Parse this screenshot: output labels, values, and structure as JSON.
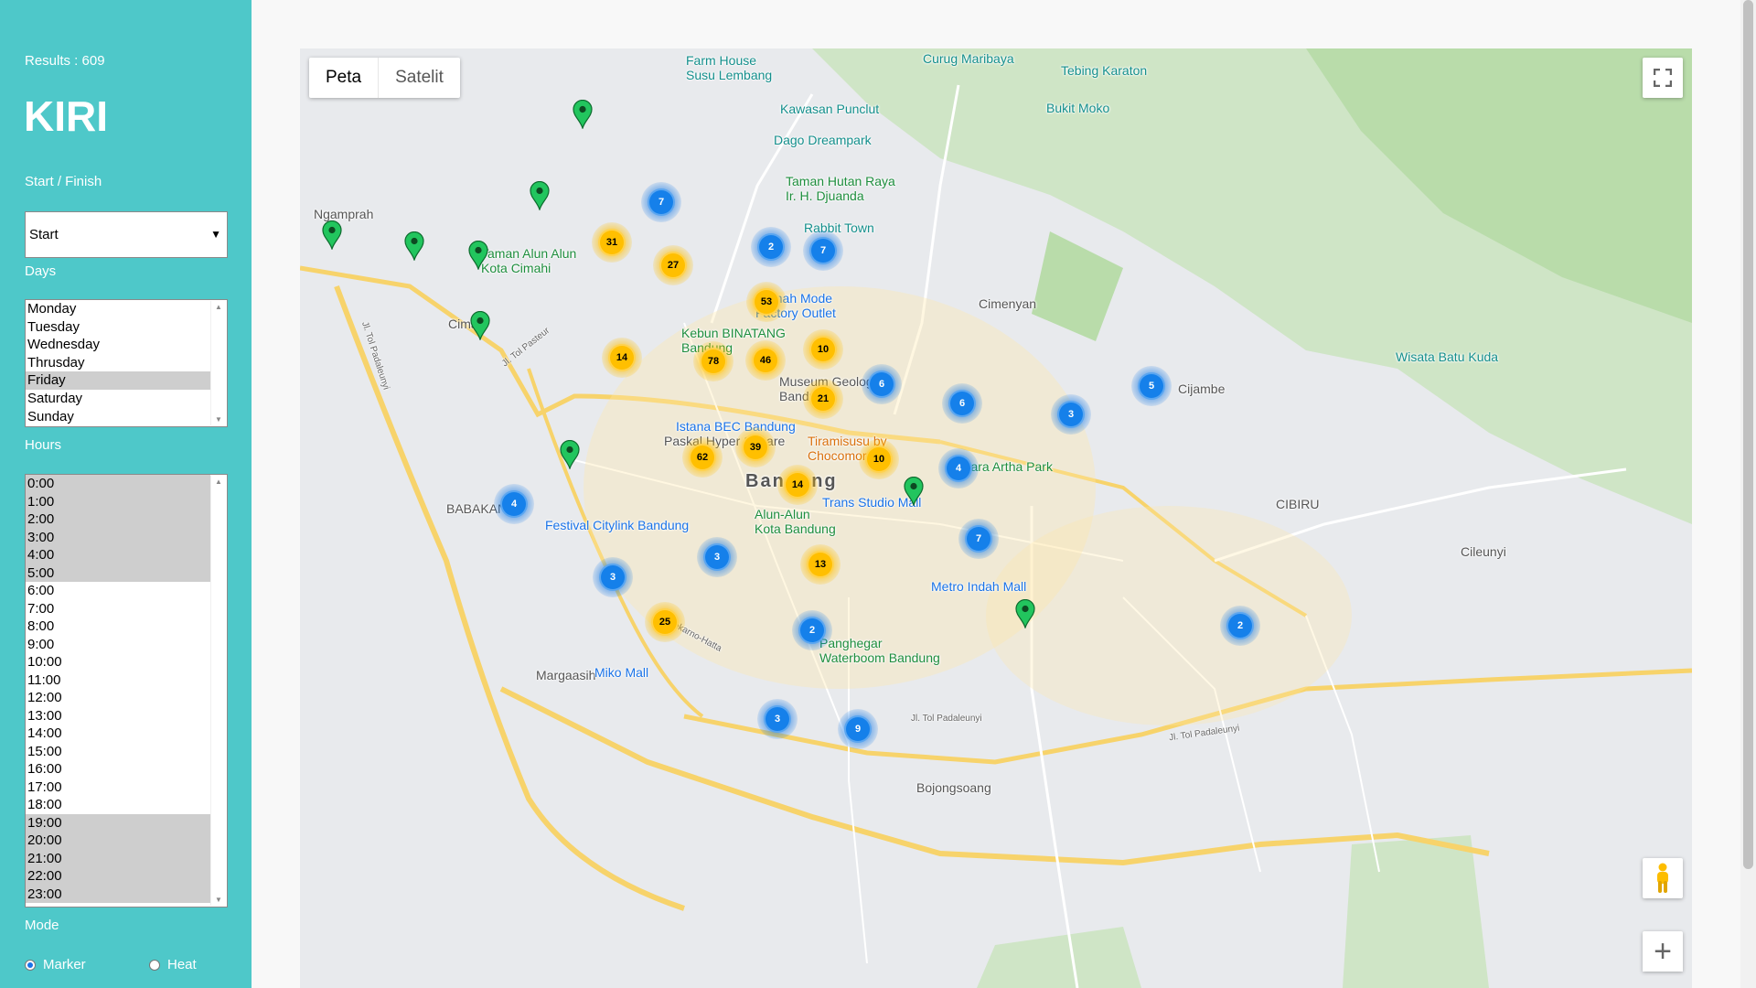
{
  "sidebar": {
    "results_text": "Results : 609",
    "app_title": "KIRI",
    "start_finish_label": "Start / Finish",
    "start_select_value": "Start",
    "days_label": "Days",
    "days": [
      {
        "label": "Monday",
        "selected": false
      },
      {
        "label": "Tuesday",
        "selected": false
      },
      {
        "label": "Wednesday",
        "selected": false
      },
      {
        "label": "Thrusday",
        "selected": false
      },
      {
        "label": "Friday",
        "selected": true
      },
      {
        "label": "Saturday",
        "selected": false
      },
      {
        "label": "Sunday",
        "selected": false
      }
    ],
    "hours_label": "Hours",
    "hours": [
      {
        "label": "0:00",
        "selected": true
      },
      {
        "label": "1:00",
        "selected": true
      },
      {
        "label": "2:00",
        "selected": true
      },
      {
        "label": "3:00",
        "selected": true
      },
      {
        "label": "4:00",
        "selected": true
      },
      {
        "label": "5:00",
        "selected": true
      },
      {
        "label": "6:00",
        "selected": false
      },
      {
        "label": "7:00",
        "selected": false
      },
      {
        "label": "8:00",
        "selected": false
      },
      {
        "label": "9:00",
        "selected": false
      },
      {
        "label": "10:00",
        "selected": false
      },
      {
        "label": "11:00",
        "selected": false
      },
      {
        "label": "12:00",
        "selected": false
      },
      {
        "label": "13:00",
        "selected": false
      },
      {
        "label": "14:00",
        "selected": false
      },
      {
        "label": "15:00",
        "selected": false
      },
      {
        "label": "16:00",
        "selected": false
      },
      {
        "label": "17:00",
        "selected": false
      },
      {
        "label": "18:00",
        "selected": false
      },
      {
        "label": "19:00",
        "selected": true
      },
      {
        "label": "20:00",
        "selected": true
      },
      {
        "label": "21:00",
        "selected": true
      },
      {
        "label": "22:00",
        "selected": true
      },
      {
        "label": "23:00",
        "selected": true
      }
    ],
    "mode_label": "Mode",
    "mode_options": {
      "marker": "Marker",
      "heat": "Heat"
    },
    "mode_selected": "marker"
  },
  "map": {
    "type_buttons": {
      "map": "Peta",
      "satellite": "Satelit"
    },
    "places": [
      {
        "text": "Farm House\nSusu Lembang",
        "color": "teal"
      },
      {
        "text": "Curug Maribaya",
        "color": "teal"
      },
      {
        "text": "Tebing Karaton",
        "color": "teal"
      },
      {
        "text": "Kawasan Punclut",
        "color": "teal"
      },
      {
        "text": "Bukit Moko",
        "color": "teal"
      },
      {
        "text": "Dago Dreampark",
        "color": "teal"
      },
      {
        "text": "Taman Hutan Raya\nIr. H. Djuanda",
        "color": "green"
      },
      {
        "text": "Rabbit Town",
        "color": "teal"
      },
      {
        "text": "Ngamprah",
        "color": "dark"
      },
      {
        "text": "Taman Alun Alun\nKota Cimahi",
        "color": "green"
      },
      {
        "text": "Rumah Mode\nFactory Outlet",
        "color": "blue"
      },
      {
        "text": "Cimenyan",
        "color": "dark"
      },
      {
        "text": "Cimahi",
        "color": "dark"
      },
      {
        "text": "Kebun BINATANG\nBandung",
        "color": "green"
      },
      {
        "text": "Museum Geologi\nBandung",
        "color": "dark"
      },
      {
        "text": "Wisata Batu Kuda",
        "color": "teal"
      },
      {
        "text": "Cijambe",
        "color": "dark"
      },
      {
        "text": "Istana BEC Bandung",
        "color": "blue"
      },
      {
        "text": "Paskal Hyper Square",
        "color": "dark"
      },
      {
        "text": "Tiramisusu by\nChocomory",
        "color": "orange"
      },
      {
        "text": "Kiara Artha Park",
        "color": "green"
      },
      {
        "text": "Bandung",
        "color": "big"
      },
      {
        "text": "BABAKAN",
        "color": "dark"
      },
      {
        "text": "Alun-Alun\nKota Bandung",
        "color": "green"
      },
      {
        "text": "Trans Studio Mall",
        "color": "blue"
      },
      {
        "text": "CIBIRU",
        "color": "dark"
      },
      {
        "text": "Festival Citylink Bandung",
        "color": "blue"
      },
      {
        "text": "Cileunyi",
        "color": "dark"
      },
      {
        "text": "Metro Indah Mall",
        "color": "blue"
      },
      {
        "text": "Panghegar\nWaterboom Bandung",
        "color": "green"
      },
      {
        "text": "Margaasih",
        "color": "dark"
      },
      {
        "text": "Miko Mall",
        "color": "blue"
      },
      {
        "text": "Bojongsoang",
        "color": "dark"
      },
      {
        "text": "Jl. Tol Padaleunyi",
        "color": "road"
      },
      {
        "text": "Jl. Tol Padaleunyi",
        "color": "road"
      },
      {
        "text": "Jl. Tol Padaleunyi",
        "color": "road"
      },
      {
        "text": "Jl. Soekarno-Hatta",
        "color": "road"
      },
      {
        "text": "Jl. Tol Pasteur",
        "color": "road"
      }
    ],
    "clusters": [
      {
        "count": "7",
        "color": "blue"
      },
      {
        "count": "31",
        "color": "yellow"
      },
      {
        "count": "27",
        "color": "yellow"
      },
      {
        "count": "2",
        "color": "blue"
      },
      {
        "count": "7",
        "color": "blue"
      },
      {
        "count": "53",
        "color": "yellow"
      },
      {
        "count": "14",
        "color": "yellow"
      },
      {
        "count": "78",
        "color": "yellow"
      },
      {
        "count": "46",
        "color": "yellow"
      },
      {
        "count": "10",
        "color": "yellow"
      },
      {
        "count": "6",
        "color": "blue"
      },
      {
        "count": "21",
        "color": "yellow"
      },
      {
        "count": "6",
        "color": "blue"
      },
      {
        "count": "3",
        "color": "blue"
      },
      {
        "count": "5",
        "color": "blue"
      },
      {
        "count": "62",
        "color": "yellow"
      },
      {
        "count": "39",
        "color": "yellow"
      },
      {
        "count": "10",
        "color": "yellow"
      },
      {
        "count": "4",
        "color": "blue"
      },
      {
        "count": "14",
        "color": "yellow"
      },
      {
        "count": "4",
        "color": "blue"
      },
      {
        "count": "7",
        "color": "blue"
      },
      {
        "count": "3",
        "color": "blue"
      },
      {
        "count": "13",
        "color": "yellow"
      },
      {
        "count": "3",
        "color": "blue"
      },
      {
        "count": "25",
        "color": "yellow"
      },
      {
        "count": "2",
        "color": "blue"
      },
      {
        "count": "2",
        "color": "blue"
      },
      {
        "count": "3",
        "color": "blue"
      },
      {
        "count": "9",
        "color": "blue"
      }
    ],
    "pin_count_visible": 10
  }
}
